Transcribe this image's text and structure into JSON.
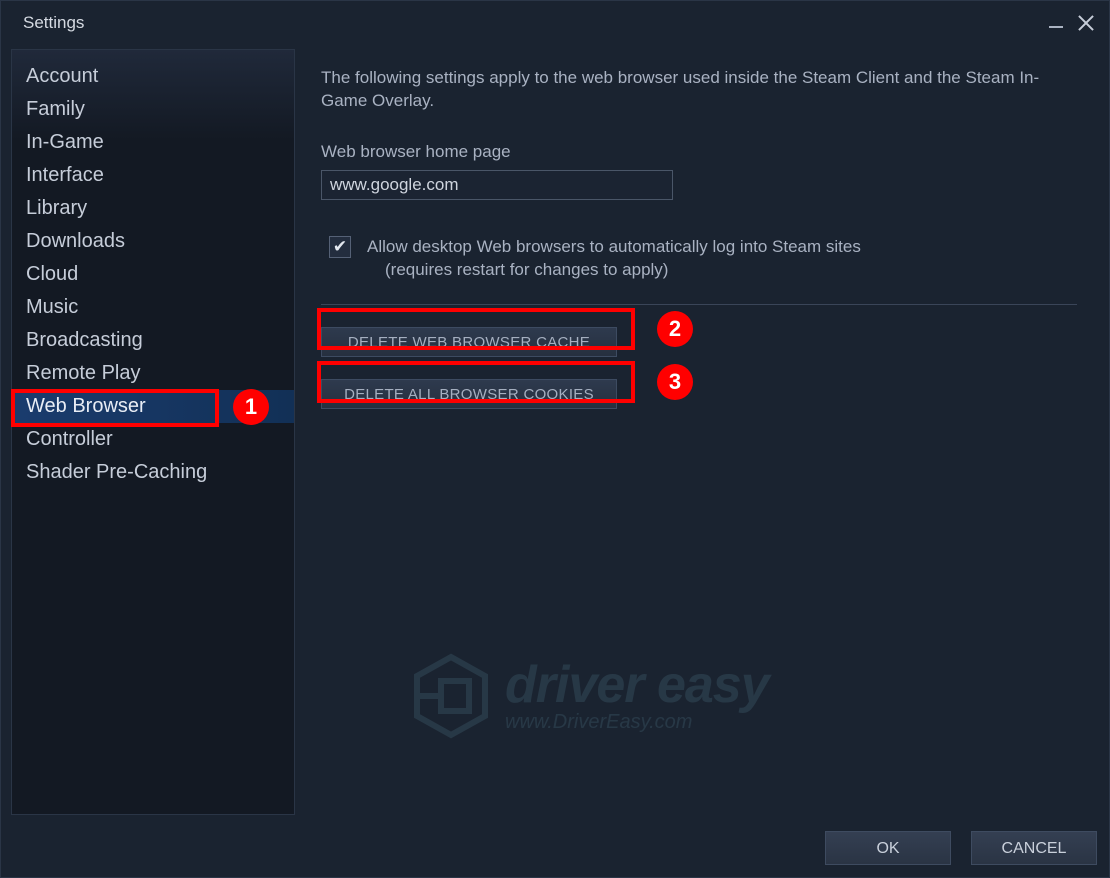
{
  "window": {
    "title": "Settings"
  },
  "sidebar": {
    "items": [
      {
        "label": "Account"
      },
      {
        "label": "Family"
      },
      {
        "label": "In-Game"
      },
      {
        "label": "Interface"
      },
      {
        "label": "Library"
      },
      {
        "label": "Downloads"
      },
      {
        "label": "Cloud"
      },
      {
        "label": "Music"
      },
      {
        "label": "Broadcasting"
      },
      {
        "label": "Remote Play"
      },
      {
        "label": "Web Browser"
      },
      {
        "label": "Controller"
      },
      {
        "label": "Shader Pre-Caching"
      }
    ],
    "selected_index": 10
  },
  "content": {
    "description": "The following settings apply to the web browser used inside the Steam Client and the Steam In-Game Overlay.",
    "homepage_label": "Web browser home page",
    "homepage_value": "www.google.com",
    "allow_desktop_checked": true,
    "allow_desktop_text_line1": "Allow desktop Web browsers to automatically log into Steam sites",
    "allow_desktop_text_line2": "(requires restart for changes to apply)",
    "delete_cache_label": "DELETE WEB BROWSER CACHE",
    "delete_cookies_label": "DELETE ALL BROWSER COOKIES"
  },
  "footer": {
    "ok_label": "OK",
    "cancel_label": "CANCEL"
  },
  "annotations": {
    "badge1": "1",
    "badge2": "2",
    "badge3": "3"
  },
  "watermark": {
    "brand": "driver easy",
    "url": "www.DriverEasy.com"
  }
}
